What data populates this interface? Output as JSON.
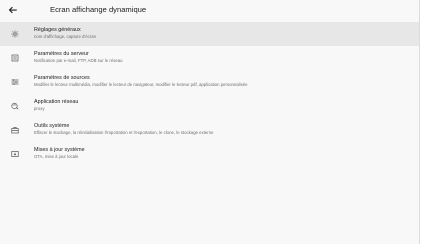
{
  "appbar": {
    "back_icon": "arrow-left-icon",
    "title": "Ecran affichange dynamique"
  },
  "items": [
    {
      "title": "Réglages généraux",
      "subtitle": "nom d'affichage, capture d'écran",
      "icon": "gear-icon",
      "selected": true
    },
    {
      "title": "Paramètres du serveur",
      "subtitle": "Notification par e-mail, FTP, ADB sur le réseau",
      "icon": "server-icon",
      "selected": false
    },
    {
      "title": "Paramètres de sources",
      "subtitle": "Modifier le lecteur multimédia, modifier le lecteur de navigateur, modifier le lecteur pdf, application personnalisée",
      "icon": "sliders-icon",
      "selected": false
    },
    {
      "title": "Application réseau",
      "subtitle": "proxy",
      "icon": "network-icon",
      "selected": false
    },
    {
      "title": "Outils système",
      "subtitle": "Effacer le stockage, la réinitialisation l'importation et l'exportation, le clone, le stockage externe",
      "icon": "toolbox-icon",
      "selected": false
    },
    {
      "title": "Mises à jour système",
      "subtitle": "OTA, mise à jour locale",
      "icon": "system-update-icon",
      "selected": false
    }
  ]
}
